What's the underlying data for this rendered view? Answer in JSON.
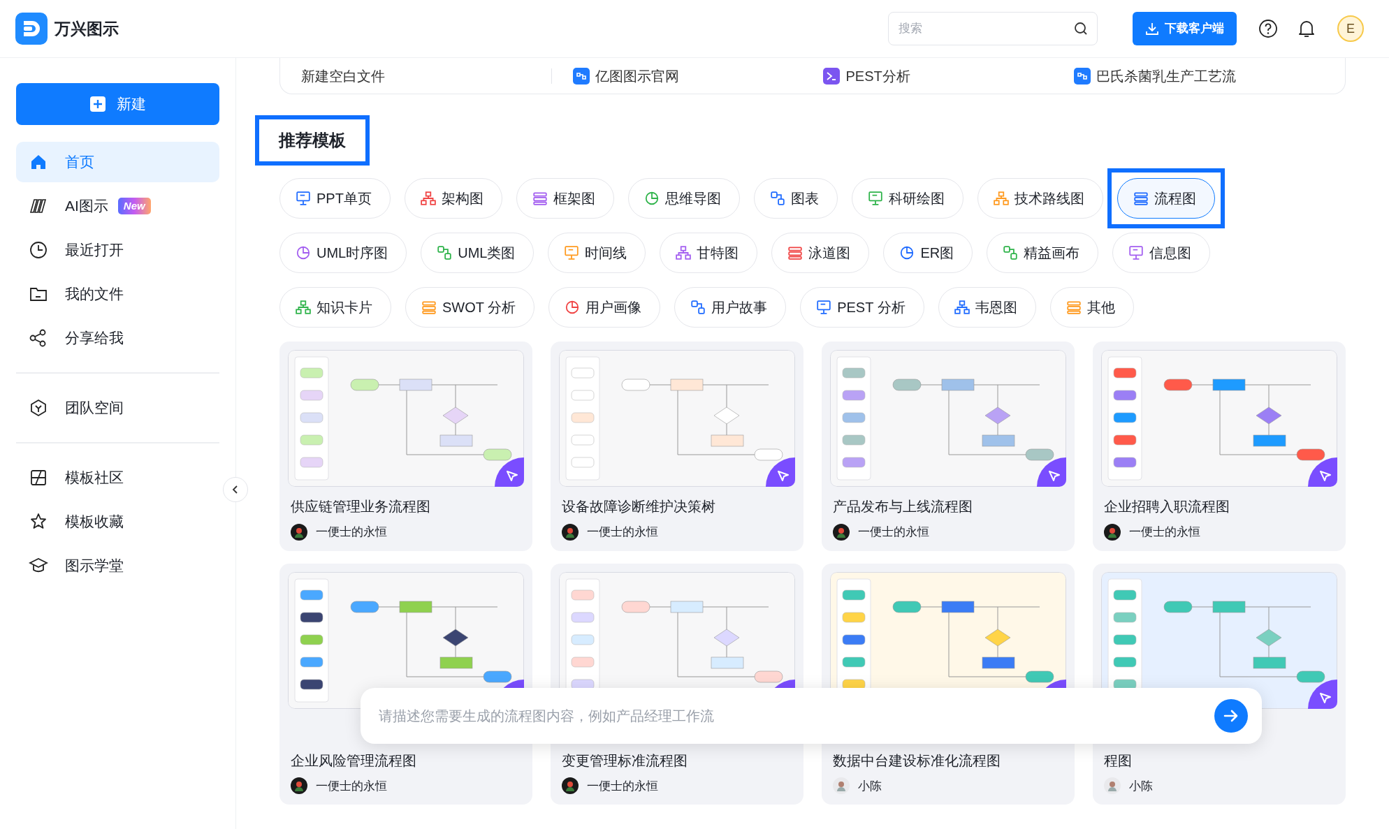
{
  "app": {
    "name": "万兴图示"
  },
  "header": {
    "search": {
      "placeholder": "搜索"
    },
    "download_button": "下载客户端",
    "avatar": "E"
  },
  "sidebar": {
    "new_button": "新建",
    "groups": [
      [
        {
          "label": "首页",
          "selected": true
        },
        {
          "label": "AI图示",
          "selected": false,
          "badge": "New"
        },
        {
          "label": "最近打开",
          "selected": false
        },
        {
          "label": "我的文件",
          "selected": false
        },
        {
          "label": "分享给我",
          "selected": false
        }
      ],
      [
        {
          "label": "团队空间",
          "selected": false
        }
      ],
      [
        {
          "label": "模板社区",
          "selected": false
        },
        {
          "label": "模板收藏",
          "selected": false
        },
        {
          "label": "图示学堂",
          "selected": false
        }
      ]
    ]
  },
  "recent_files": [
    {
      "name": "新建空白文件",
      "kind": "blank"
    },
    {
      "name": "亿图图示官网",
      "kind": "link",
      "color": "#1f7bff"
    },
    {
      "name": "PEST分析",
      "kind": "doc",
      "color": "#7b55f0"
    },
    {
      "name": "巴氏杀菌乳生产工艺流",
      "kind": "link",
      "color": "#1f7bff"
    }
  ],
  "section": {
    "title": "推荐模板",
    "highlighted": true
  },
  "categories": [
    [
      {
        "label": "PPT单页",
        "color": "#1f6bff",
        "selected": false
      },
      {
        "label": "架构图",
        "color": "#f04343",
        "selected": false
      },
      {
        "label": "框架图",
        "color": "#a35ef0",
        "selected": false
      },
      {
        "label": "思维导图",
        "color": "#2eb34a",
        "selected": false
      },
      {
        "label": "图表",
        "color": "#1f6bff",
        "selected": false
      },
      {
        "label": "科研绘图",
        "color": "#2eb34a",
        "selected": false
      },
      {
        "label": "技术路线图",
        "color": "#ff9a1f",
        "selected": false
      },
      {
        "label": "流程图",
        "color": "#1f6bff",
        "selected": true
      }
    ],
    [
      {
        "label": "UML时序图",
        "color": "#a35ef0",
        "selected": false
      },
      {
        "label": "UML类图",
        "color": "#2eb34a",
        "selected": false
      },
      {
        "label": "时间线",
        "color": "#ff9a1f",
        "selected": false
      },
      {
        "label": "甘特图",
        "color": "#a35ef0",
        "selected": false
      },
      {
        "label": "泳道图",
        "color": "#f04343",
        "selected": false
      },
      {
        "label": "ER图",
        "color": "#1f6bff",
        "selected": false
      },
      {
        "label": "精益画布",
        "color": "#2eb34a",
        "selected": false
      },
      {
        "label": "信息图",
        "color": "#a35ef0",
        "selected": false
      }
    ],
    [
      {
        "label": "知识卡片",
        "color": "#2eb34a",
        "selected": false
      },
      {
        "label": "SWOT 分析",
        "color": "#ff9a1f",
        "selected": false
      },
      {
        "label": "用户画像",
        "color": "#f04343",
        "selected": false
      },
      {
        "label": "用户故事",
        "color": "#1f6bff",
        "selected": false
      },
      {
        "label": "PEST 分析",
        "color": "#1f6bff",
        "selected": false
      },
      {
        "label": "韦恩图",
        "color": "#1f6bff",
        "selected": false
      },
      {
        "label": "其他",
        "color": "#ff9a1f",
        "selected": false
      }
    ]
  ],
  "templates": [
    {
      "title": "供应链管理业务流程图",
      "author": "一便士的永恒"
    },
    {
      "title": "设备故障诊断维护决策树",
      "author": "一便士的永恒"
    },
    {
      "title": "产品发布与上线流程图",
      "author": "一便士的永恒"
    },
    {
      "title": "企业招聘入职流程图",
      "author": "一便士的永恒"
    },
    {
      "title": "企业风险管理流程图",
      "author": "一便士的永恒"
    },
    {
      "title": "变更管理标准流程图",
      "author": "一便士的永恒"
    },
    {
      "title": "数据中台建设标准化流程图",
      "author": "小陈"
    },
    {
      "title": "程图",
      "author": "小陈"
    }
  ],
  "ai_prompt": {
    "placeholder": "请描述您需要生成的流程图内容，例如产品经理工作流"
  }
}
